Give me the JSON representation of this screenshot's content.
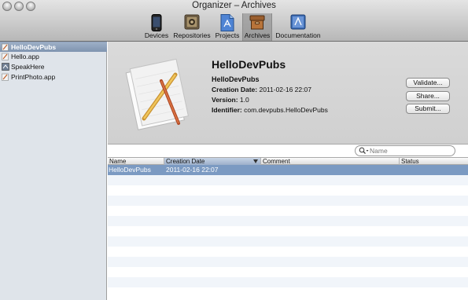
{
  "window": {
    "title": "Organizer – Archives"
  },
  "toolbar": {
    "items": [
      {
        "label": "Devices"
      },
      {
        "label": "Repositories"
      },
      {
        "label": "Projects"
      },
      {
        "label": "Archives",
        "selected": true
      },
      {
        "label": "Documentation"
      }
    ]
  },
  "sidebar": {
    "items": [
      {
        "label": "HelloDevPubs",
        "selected": true,
        "icon": "app-archive-icon"
      },
      {
        "label": "Hello.app",
        "icon": "app-icon"
      },
      {
        "label": "SpeakHere",
        "icon": "app-icon"
      },
      {
        "label": "PrintPhoto.app",
        "icon": "app-icon"
      }
    ]
  },
  "detail": {
    "title": "HelloDevPubs",
    "name": "HelloDevPubs",
    "creation_date_label": "Creation Date:",
    "creation_date": "2011-02-16 22:07",
    "version_label": "Version:",
    "version": "1.0",
    "identifier_label": "Identifier:",
    "identifier": "com.devpubs.HelloDevPubs",
    "buttons": {
      "validate": "Validate...",
      "share": "Share...",
      "submit": "Submit..."
    }
  },
  "search": {
    "placeholder": "Name"
  },
  "table": {
    "columns": [
      "Name",
      "Creation Date",
      "Comment",
      "Status"
    ],
    "sorted_column": "Creation Date",
    "rows": [
      {
        "name": "HelloDevPubs",
        "creation_date": "2011-02-16 22:07",
        "comment": "",
        "status": ""
      }
    ]
  },
  "colors": {
    "selection": "#7b9ac2",
    "sidebar_bg": "#dfe4ea"
  }
}
